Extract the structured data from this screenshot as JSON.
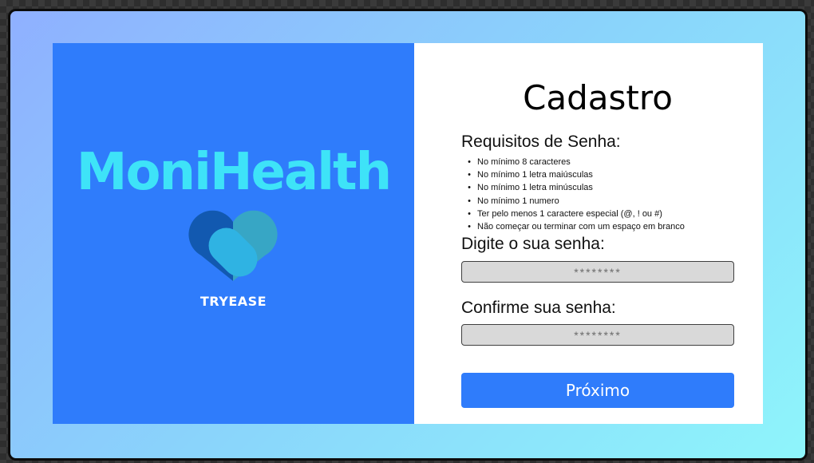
{
  "brand": {
    "name": "MoniHealth",
    "company": "TRYEASE",
    "logo_icon": "heart-logo-icon"
  },
  "form": {
    "title": "Cadastro",
    "requirements_title": "Requisitos de Senha:",
    "requirements": [
      "No mínimo 8 caracteres",
      "No mínimo 1 letra maiúsculas",
      "No mínimo 1 letra minúsculas",
      "No mínimo 1 numero",
      "Ter pelo menos 1 caractere especial (@, ! ou #)",
      "Não começar ou terminar com um espaço em branco"
    ],
    "password_label": "Digite o sua senha:",
    "password_placeholder": "********",
    "confirm_label": "Confirme sua senha:",
    "confirm_placeholder": "********",
    "next_button": "Próximo"
  },
  "colors": {
    "brand_blue": "#2f7cfb",
    "brand_cyan": "#3ee3f8",
    "input_gray": "#d9d9d9"
  }
}
